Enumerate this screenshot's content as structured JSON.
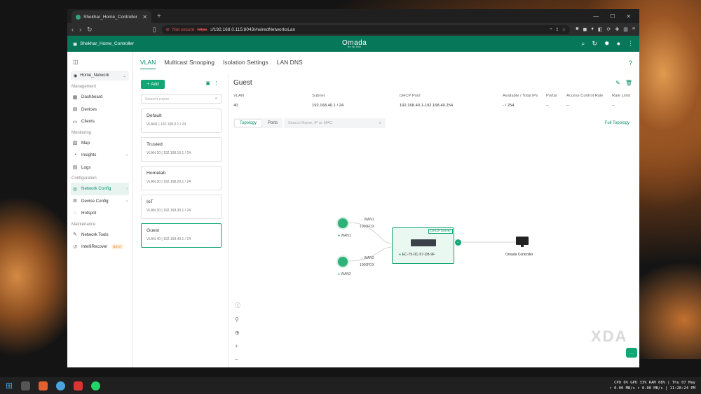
{
  "browser": {
    "tab_title": "Shekhar_Home_Controller",
    "tab_close": "✕",
    "new_tab": "+",
    "win_min": "—",
    "win_max": "☐",
    "win_close": "✕",
    "security_label": "Not secure",
    "url_scheme": "https",
    "url_rest": "://192.168.0.115:8043/#wiredNetworksLan"
  },
  "app": {
    "site_name": "Shekhar_Home_Controller",
    "logo": "Omada",
    "logo_sub": "by tp-link",
    "accent": "#07775a"
  },
  "sidebar": {
    "site_select": "Home_Network",
    "sections": [
      {
        "title": "Management",
        "items": [
          "Dashboard",
          "Devices",
          "Clients"
        ]
      },
      {
        "title": "Monitoring",
        "items": [
          "Map",
          "Insights",
          "Logs"
        ]
      },
      {
        "title": "Configuration",
        "items": [
          "Network Config",
          "Device Config",
          "Hotspot"
        ]
      },
      {
        "title": "Maintenance",
        "items": [
          "Network Tools",
          "IntelliRecover"
        ]
      }
    ],
    "beta_badge": "BETA"
  },
  "tabs": [
    "VLAN",
    "Multicast Snooping",
    "Isolation Settings",
    "LAN DNS"
  ],
  "vlan_panel": {
    "add_label": "Add",
    "search_placeholder": "Search name",
    "items": [
      {
        "name": "Default",
        "desc": "VLAN1  |  192.168.0.1 / 24"
      },
      {
        "name": "Trusted",
        "desc": "VLAN 10  |  192.168.10.1 / 24"
      },
      {
        "name": "Homelab",
        "desc": "VLAN 20  |  192.168.20.1 / 24"
      },
      {
        "name": "IoT",
        "desc": "VLAN 30  |  192.168.30.1 / 24"
      },
      {
        "name": "Guest",
        "desc": "VLAN 40  |  192.168.40.1 / 24"
      }
    ]
  },
  "detail": {
    "title": "Guest",
    "columns": [
      "VLAN",
      "Subnet",
      "DHCP Pool",
      "Available / Total IPs",
      "Portal",
      "Access Control Rule",
      "Rate Limit"
    ],
    "values": [
      "40",
      "192.168.40.1 / 24",
      "192.168.40.1-192.168.40.254",
      "- / 254",
      "--",
      "--",
      "--"
    ],
    "segments": [
      "Topology",
      "Ports"
    ],
    "search_placeholder": "Search Name, IP or MAC",
    "full_topology": "Full Topology"
  },
  "topology": {
    "dhcp_tag": "DHCP Server",
    "switch_mac": "EC-75-0C-57-D8-9F",
    "wan1_name": "WAN1",
    "wan2_name": "WAN2",
    "wan1_link": "→ WAN1",
    "wan2_link": "→ WAN2",
    "speed1": "1000FDX",
    "speed2": "1000FDX",
    "controller": "Omada Controller"
  },
  "watermark": "XDA",
  "tray": {
    "line1": "CPU  6% GPU 33% RAM 68% | Thu 07 May",
    "line2": "⬇ 0.00 MB/s ⬆ 0.00 MB/s | 11:28:24 PM"
  }
}
